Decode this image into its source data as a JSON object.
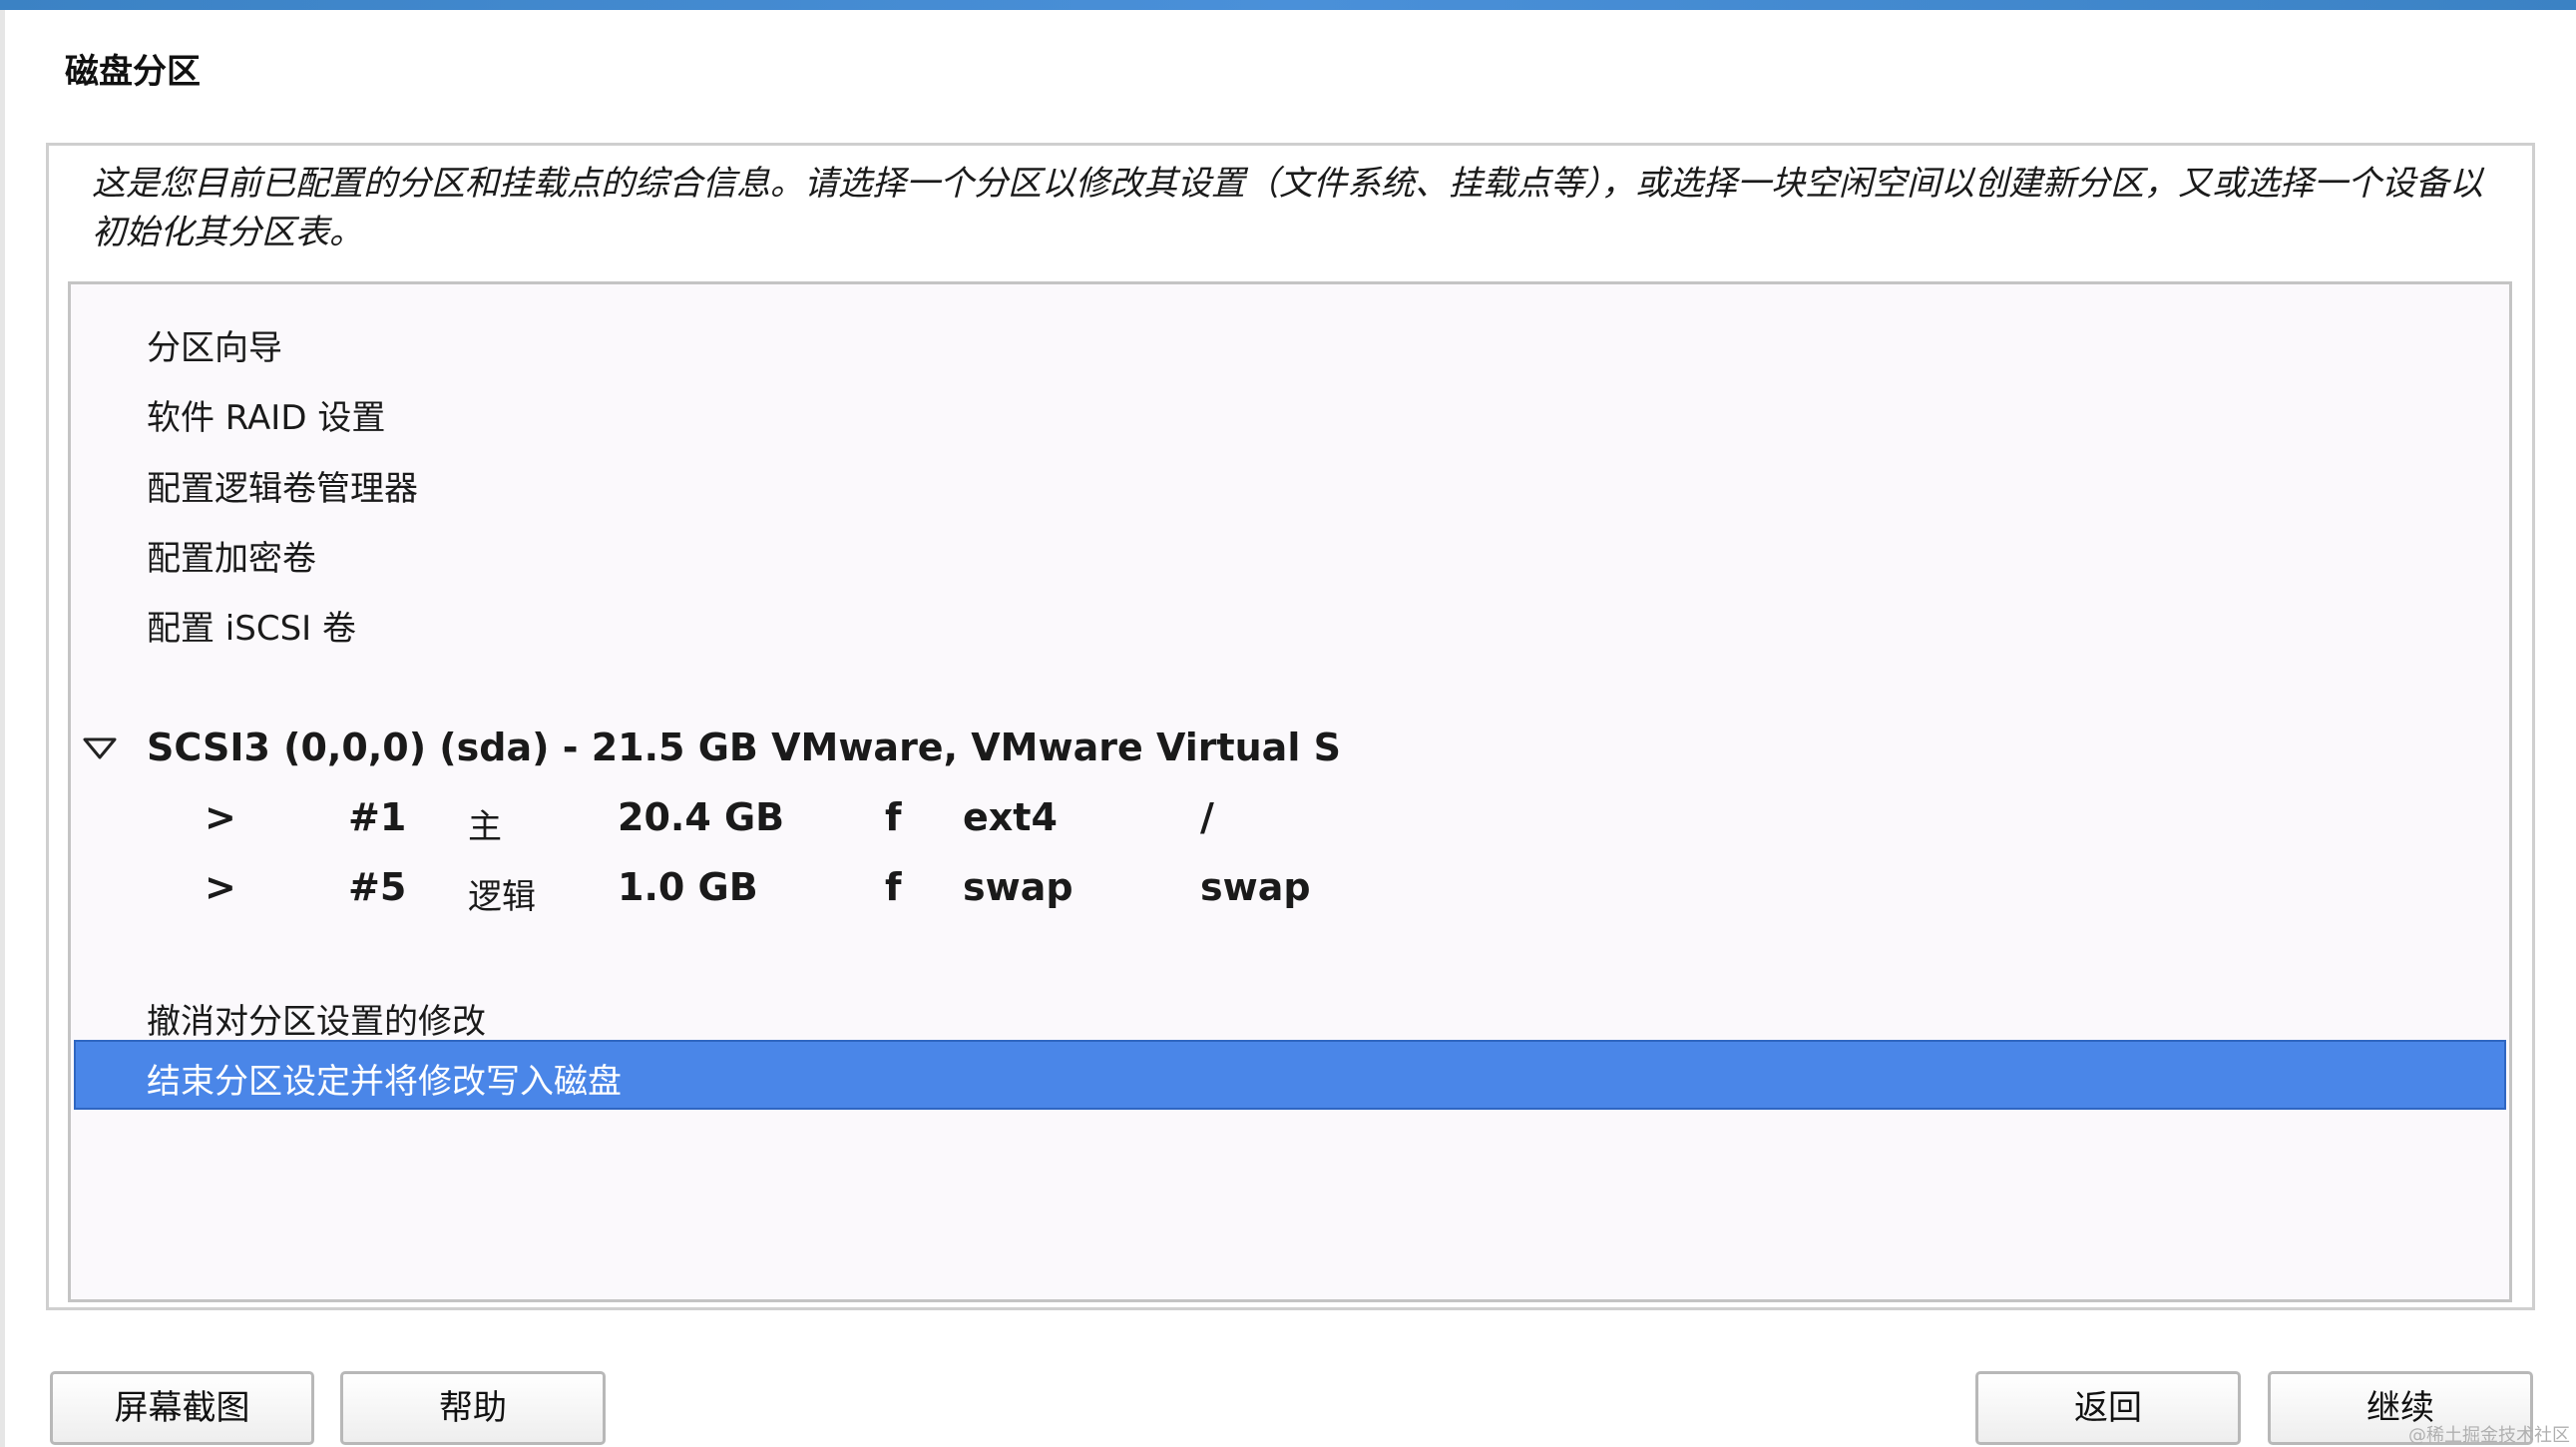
{
  "header": {
    "title": "磁盘分区"
  },
  "description": "这是您目前已配置的分区和挂载点的综合信息。请选择一个分区以修改其设置（文件系统、挂载点等），或选择一块空闲空间以创建新分区，又或选择一个设备以初始化其分区表。",
  "menu": {
    "guided": "分区向导",
    "raid": "软件 RAID 设置",
    "lvm": "配置逻辑卷管理器",
    "encrypted": "配置加密卷",
    "iscsi": "配置 iSCSI 卷"
  },
  "disk": {
    "label": "SCSI3 (0,0,0) (sda) - 21.5 GB VMware, VMware Virtual S",
    "partitions": [
      {
        "arrow": ">",
        "number": "#1",
        "type": "主",
        "size": "20.4 GB",
        "flag": "f",
        "fs": "ext4",
        "mount": "/"
      },
      {
        "arrow": ">",
        "number": "#5",
        "type": "逻辑",
        "size": "1.0 GB",
        "flag": "f",
        "fs": "swap",
        "mount": "swap"
      }
    ]
  },
  "actions": {
    "undo": "撤消对分区设置的修改",
    "finish": "结束分区设定并将修改写入磁盘"
  },
  "buttons": {
    "screenshot": "屏幕截图",
    "help": "帮助",
    "back": "返回",
    "continue": "继续"
  },
  "watermark": "@稀土掘金技术社区",
  "colors": {
    "selection": "#4a86e8",
    "top_bar": "#4a90d9"
  }
}
